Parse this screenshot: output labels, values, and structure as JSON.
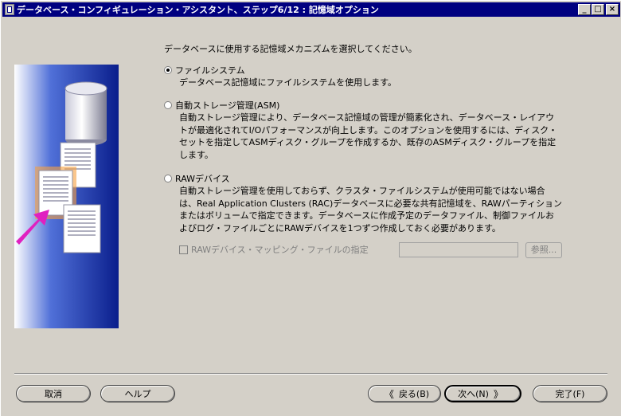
{
  "window": {
    "title": "データベース・コンフィギュレーション・アシスタント、ステップ6/12 : 記憶域オプション",
    "minimize_glyph": "_",
    "maximize_glyph": "□",
    "close_glyph": "×"
  },
  "main": {
    "prompt": "データベースに使用する記憶域メカニズムを選択してください。",
    "options": [
      {
        "label": "ファイルシステム",
        "description": "データベース記憶域にファイルシステムを使用します。",
        "selected": true
      },
      {
        "label": "自動ストレージ管理(ASM)",
        "description_lines": [
          "自動ストレージ管理により、データベース記憶域の管理が簡素化され、データベース・レイアウ",
          "トが最適化されてI/Oパフォーマンスが向上します。このオプションを使用するには、ディスク・",
          "セットを指定してASMディスク・グループを作成するか、既存のASMディスク・グループを指定",
          "します。"
        ],
        "selected": false
      },
      {
        "label": "RAWデバイス",
        "description_lines": [
          "自動ストレージ管理を使用しておらず、クラスタ・ファイルシステムが使用可能ではない場合",
          "は、Real Application Clusters (RAC)データベースに必要な共有記憶域を、RAWパーティション",
          "またはボリュームで指定できます。データベースに作成予定のデータファイル、制御ファイルお",
          "よびログ・ファイルごとにRAWデバイスを1つずつ作成しておく必要があります。"
        ],
        "selected": false
      }
    ],
    "raw_mapping": {
      "checkbox_label": "RAWデバイス・マッピング・ファイルの指定",
      "checked": false,
      "enabled": false,
      "field_value": "",
      "browse_label": "参照..."
    }
  },
  "footer": {
    "cancel_label": "取消",
    "help_label": "ヘルプ",
    "back_label": "戻る(B)",
    "back_arrow": "《",
    "next_label": "次へ(N)",
    "next_arrow": "》",
    "finish_label": "完了(F)"
  },
  "colors": {
    "titlebar": "#000080",
    "window_bg": "#d4d0c8",
    "illustration_bg": "#102a9c",
    "arrow": "#e020c0",
    "document_highlight": "#f7a040"
  }
}
